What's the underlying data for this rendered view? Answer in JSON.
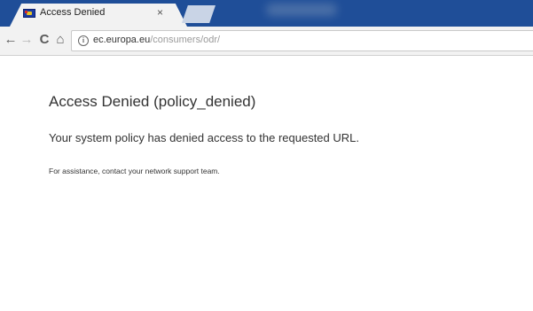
{
  "browser": {
    "tab": {
      "title": "Access Denied",
      "close_glyph": "×",
      "favicon": "eu-flag-icon"
    },
    "toolbar": {
      "back_glyph": "←",
      "forward_glyph": "→",
      "reload_glyph": "C",
      "home_glyph": "⌂",
      "info_glyph": "i",
      "url_host": "ec.europa.eu",
      "url_path": "/consumers/odr/"
    },
    "colors": {
      "tabstrip": "#1f4e98",
      "toolbar": "#f2f2f2"
    }
  },
  "page": {
    "title": "Access Denied (policy_denied)",
    "message": "Your system policy has denied access to the requested URL.",
    "support": "For assistance, contact your network support team."
  }
}
